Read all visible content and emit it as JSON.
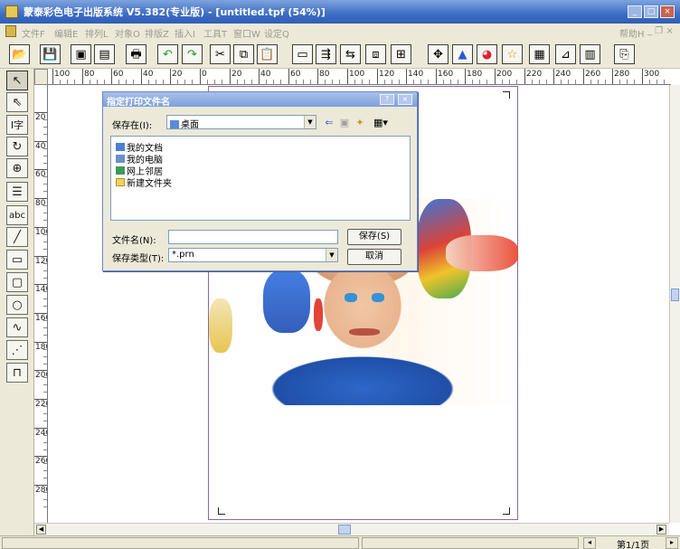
{
  "app": {
    "title": "蒙泰彩色电子出版系统 V5.382(专业版) - [untitled.tpf (54%)]",
    "window_buttons": [
      "_",
      "□",
      "×"
    ]
  },
  "menu": {
    "items": [
      "文件F",
      "编辑E",
      "排列L",
      "对象O",
      "排版Z",
      "插入I",
      "工具T",
      "窗口W",
      "设定Q"
    ],
    "help": "帮助H",
    "mdi_buttons": "_ ❐ ×"
  },
  "toolbar": {
    "buttons": [
      {
        "name": "open-icon",
        "glyph": "📂"
      },
      {
        "name": "save-icon",
        "glyph": "💾"
      },
      {
        "name": "import-image-icon",
        "glyph": "▣"
      },
      {
        "name": "export-icon",
        "glyph": "▤"
      },
      {
        "name": "print-icon",
        "glyph": "🖶"
      },
      {
        "name": "undo-icon",
        "glyph": "↶"
      },
      {
        "name": "redo-icon",
        "glyph": "↷"
      },
      {
        "name": "cut-icon",
        "glyph": "✂"
      },
      {
        "name": "copy-icon",
        "glyph": "⧉"
      },
      {
        "name": "paste-icon",
        "glyph": "📋"
      },
      {
        "name": "text-frame-icon",
        "glyph": "▭"
      },
      {
        "name": "text-flow-icon",
        "glyph": "⇶"
      },
      {
        "name": "text-wrap-icon",
        "glyph": "⇆"
      },
      {
        "name": "frame-overlap-icon",
        "glyph": "⧈"
      },
      {
        "name": "grid-icon",
        "glyph": "⊞"
      },
      {
        "name": "move-icon",
        "glyph": "✥"
      },
      {
        "name": "color-fill-icon",
        "glyph": "▲"
      },
      {
        "name": "color-picker-icon",
        "glyph": "◕"
      },
      {
        "name": "star-icon",
        "glyph": "☆"
      },
      {
        "name": "table-icon",
        "glyph": "▦"
      },
      {
        "name": "layer-icon",
        "glyph": "⊿"
      },
      {
        "name": "chart-icon",
        "glyph": "▥"
      },
      {
        "name": "preview-icon",
        "glyph": "⎘"
      }
    ]
  },
  "tools": [
    {
      "name": "select-tool-icon",
      "glyph": "↖"
    },
    {
      "name": "node-select-tool-icon",
      "glyph": "⇖"
    },
    {
      "name": "text-tool-icon",
      "glyph": "I字"
    },
    {
      "name": "rotate-tool-icon",
      "glyph": "↻"
    },
    {
      "name": "zoom-tool-icon",
      "glyph": "⊕"
    },
    {
      "name": "text-block-tool-icon",
      "glyph": "☰"
    },
    {
      "name": "abc-tool-icon",
      "glyph": "abc"
    },
    {
      "name": "line-tool-icon",
      "glyph": "╱"
    },
    {
      "name": "rectangle-tool-icon",
      "glyph": "▭"
    },
    {
      "name": "rounded-rect-tool-icon",
      "glyph": "▢"
    },
    {
      "name": "ellipse-tool-icon",
      "glyph": "○"
    },
    {
      "name": "curve-tool-icon",
      "glyph": "∿"
    },
    {
      "name": "polyline-tool-icon",
      "glyph": "⋰"
    },
    {
      "name": "table-tool-icon",
      "glyph": "⊓"
    }
  ],
  "ruler": {
    "horizontal_labels": [
      "100",
      "80",
      "60",
      "40",
      "20",
      "0",
      "20",
      "40",
      "60",
      "80",
      "100",
      "120",
      "140",
      "160",
      "180",
      "200",
      "220",
      "240",
      "260",
      "280",
      "300"
    ],
    "vertical_labels": [
      "20",
      "40",
      "60",
      "80",
      "100",
      "120",
      "140",
      "160",
      "180",
      "200",
      "220",
      "240",
      "260",
      "280"
    ]
  },
  "dialog": {
    "title": "指定打印文件名",
    "title_buttons": [
      "?",
      "×"
    ],
    "save_in_label": "保存在(I):",
    "save_in_value": "桌面",
    "files": [
      "我的文档",
      "我的电脑",
      "网上邻居",
      "新建文件夹"
    ],
    "filename_label": "文件名(N):",
    "filename_value": "",
    "filetype_label": "保存类型(T):",
    "filetype_value": "*.prn",
    "save_button": "保存(S)",
    "cancel_button": "取消"
  },
  "status": {
    "page_indicator": "第1/1页"
  },
  "colors": {
    "titlebar": "#3d6cc3",
    "chrome": "#ece9d8",
    "page_border": "#8a6a9a"
  }
}
